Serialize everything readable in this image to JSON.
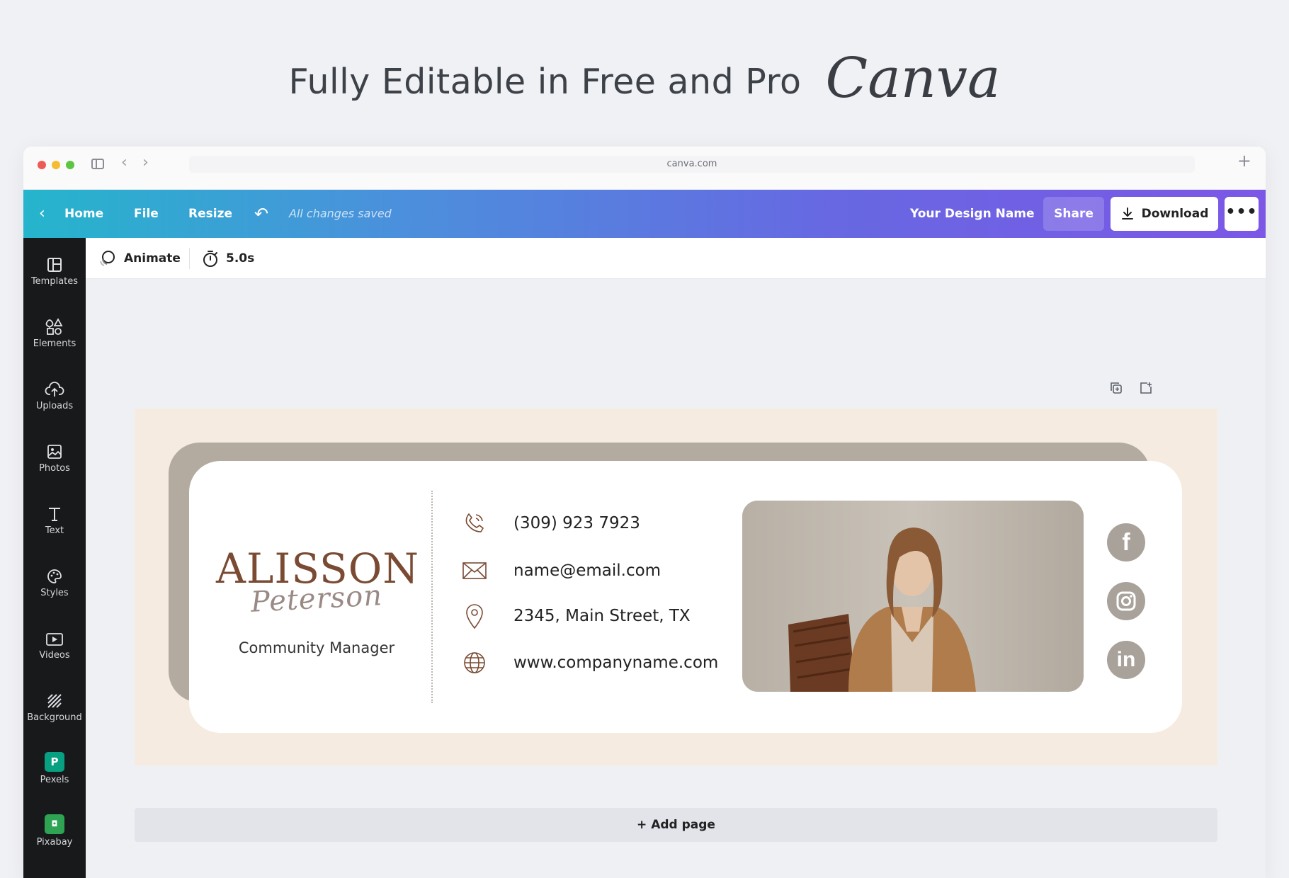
{
  "headline": {
    "text": "Fully Editable in Free and Pro",
    "logo_text": "Canva"
  },
  "browser": {
    "url": "canva.com"
  },
  "appbar": {
    "home": "Home",
    "file": "File",
    "resize": "Resize",
    "save_status": "All changes saved",
    "design_name": "Your Design Name",
    "share": "Share",
    "download": "Download",
    "more": "•••"
  },
  "rail": {
    "items": [
      {
        "label": "Templates",
        "icon": "templates-icon"
      },
      {
        "label": "Elements",
        "icon": "elements-icon"
      },
      {
        "label": "Uploads",
        "icon": "upload-icon"
      },
      {
        "label": "Photos",
        "icon": "photos-icon"
      },
      {
        "label": "Text",
        "icon": "text-icon"
      },
      {
        "label": "Styles",
        "icon": "palette-icon"
      },
      {
        "label": "Videos",
        "icon": "video-icon"
      },
      {
        "label": "Background",
        "icon": "background-icon"
      },
      {
        "label": "Pexels",
        "icon": "pexels-icon"
      },
      {
        "label": "Pixabay",
        "icon": "pixabay-icon"
      }
    ]
  },
  "toolbar": {
    "animate": "Animate",
    "duration": "5.0s"
  },
  "signature": {
    "first_name": "ALISSON",
    "last_name": "Peterson",
    "role": "Community Manager",
    "phone": "(309) 923 7923",
    "email": "name@email.com",
    "address": "2345, Main Street, TX",
    "website": "www.companyname.com",
    "colors": {
      "page_bg": "#f5ebe1",
      "back_card": "#b3ab9f",
      "name": "#7a4a33",
      "social": "#a9a29a"
    }
  },
  "canvas": {
    "add_page": "+ Add page"
  }
}
